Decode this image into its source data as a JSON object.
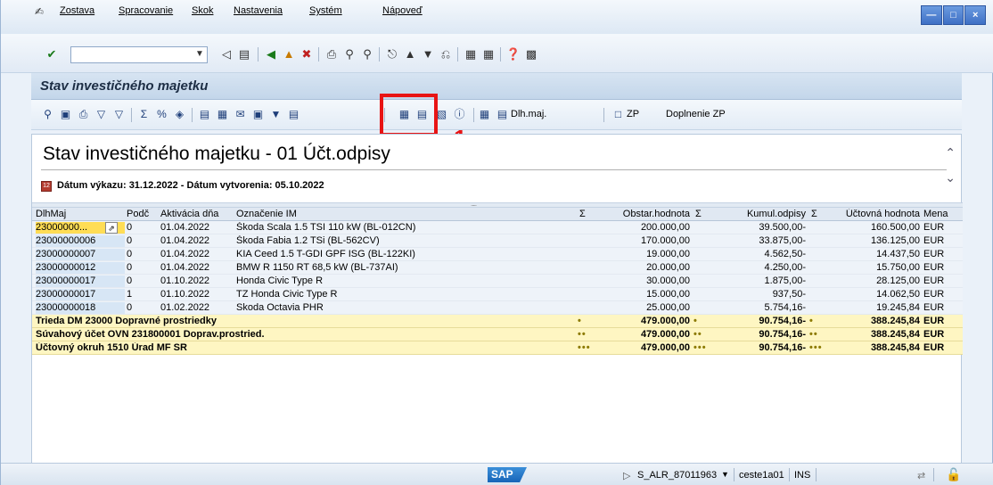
{
  "menu": {
    "items": [
      "Zostava",
      "Spracovanie",
      "Skok",
      "Nastavenia",
      "Systém",
      "Nápoveď"
    ]
  },
  "title": "Stav investičného majetku",
  "app_toolbar": {
    "dlh_maj": "Dlh.maj.",
    "zp": "ZP",
    "doplnenie_zp": "Doplnenie ZP"
  },
  "annotation": {
    "number": "1",
    "color": "#e81414"
  },
  "report": {
    "heading": "Stav investičného majetku - 01 Účt.odpisy",
    "subtitle": "Dátum výkazu: 31.12.2022 - Dátum vytvorenia: 05.10.2022"
  },
  "grid": {
    "headers": {
      "dlhmaj": "DlhMaj",
      "podc": "Podč",
      "aktivacia": "Aktivácia dňa",
      "oznacenie": "Označenie IM",
      "sum1": "Σ",
      "obstar": "Obstar.hodnota",
      "sum2": "Σ",
      "kumul": "Kumul.odpisy",
      "sum3": "Σ",
      "uctovna": "Účtovná hodnota",
      "mena": "Mena"
    },
    "rows": [
      {
        "dlhmaj": "23000000...",
        "podc": "0",
        "aktivacia": "01.04.2022",
        "oznacenie": "Škoda Scala 1.5 TSI 110 kW (BL-012CN)",
        "obstar": "200.000,00",
        "kumul": "39.500,00-",
        "uctovna": "160.500,00",
        "mena": "EUR"
      },
      {
        "dlhmaj": "23000000006",
        "podc": "0",
        "aktivacia": "01.04.2022",
        "oznacenie": "Škoda Fabia 1.2 TSi (BL-562CV)",
        "obstar": "170.000,00",
        "kumul": "33.875,00-",
        "uctovna": "136.125,00",
        "mena": "EUR"
      },
      {
        "dlhmaj": "23000000007",
        "podc": "0",
        "aktivacia": "01.04.2022",
        "oznacenie": "KIA Ceed 1.5 T-GDI GPF ISG (BL-122KI)",
        "obstar": "19.000,00",
        "kumul": "4.562,50-",
        "uctovna": "14.437,50",
        "mena": "EUR"
      },
      {
        "dlhmaj": "23000000012",
        "podc": "0",
        "aktivacia": "01.04.2022",
        "oznacenie": "BMW R 1150 RT 68,5 kW (BL-737AI)",
        "obstar": "20.000,00",
        "kumul": "4.250,00-",
        "uctovna": "15.750,00",
        "mena": "EUR"
      },
      {
        "dlhmaj": "23000000017",
        "podc": "0",
        "aktivacia": "01.10.2022",
        "oznacenie": "Honda Civic Type R",
        "obstar": "30.000,00",
        "kumul": "1.875,00-",
        "uctovna": "28.125,00",
        "mena": "EUR"
      },
      {
        "dlhmaj": "23000000017",
        "podc": "1",
        "aktivacia": "01.10.2022",
        "oznacenie": "TZ Honda Civic Type R",
        "obstar": "15.000,00",
        "kumul": "937,50-",
        "uctovna": "14.062,50",
        "mena": "EUR"
      },
      {
        "dlhmaj": "23000000018",
        "podc": "0",
        "aktivacia": "01.02.2022",
        "oznacenie": "Skoda Octavia PHR",
        "obstar": "25.000,00",
        "kumul": "5.754,16-",
        "uctovna": "19.245,84",
        "mena": "EUR"
      }
    ],
    "sums": [
      {
        "label": "Trieda DM 23000 Dopravné prostriedky",
        "dots": "•",
        "obstar": "479.000,00",
        "kumul": "90.754,16-",
        "uctovna": "388.245,84",
        "mena": "EUR"
      },
      {
        "label": "Súvahový účet OVN 231800001 Doprav.prostried.",
        "dots": "••",
        "obstar": "479.000,00",
        "kumul": "90.754,16-",
        "uctovna": "388.245,84",
        "mena": "EUR"
      },
      {
        "label": "Účtovný okruh 1510 Úrad MF SR",
        "dots": "•••",
        "obstar": "479.000,00",
        "kumul": "90.754,16-",
        "uctovna": "388.245,84",
        "mena": "EUR"
      }
    ]
  },
  "status": {
    "transaction": "S_ALR_87011963",
    "user": "ceste1a01",
    "mode": "INS"
  }
}
